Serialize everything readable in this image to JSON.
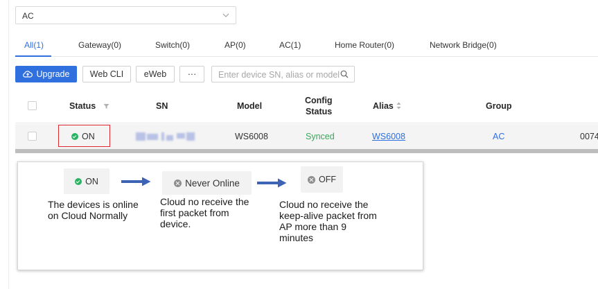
{
  "group_select": {
    "value": "AC"
  },
  "tabs": [
    {
      "label": "All(1)",
      "active": true
    },
    {
      "label": "Gateway(0)"
    },
    {
      "label": "Switch(0)"
    },
    {
      "label": "AP(0)"
    },
    {
      "label": "AC(1)"
    },
    {
      "label": "Home Router(0)"
    },
    {
      "label": "Network Bridge(0)"
    }
  ],
  "toolbar": {
    "upgrade_label": "Upgrade",
    "webcli_label": "Web CLI",
    "eweb_label": "eWeb",
    "more_label": "···",
    "search_placeholder": "Enter device SN, alias or model"
  },
  "table": {
    "headers": {
      "status": "Status",
      "sn": "SN",
      "model": "Model",
      "config_status_line1": "Config",
      "config_status_line2": "Status",
      "alias": "Alias",
      "group": "Group"
    },
    "rows": [
      {
        "status": "ON",
        "model": "WS6008",
        "config_status": "Synced",
        "alias": "WS6008",
        "group": "AC",
        "trailing": "0074"
      }
    ]
  },
  "legend": {
    "on": {
      "label": "ON",
      "desc": [
        "The devices is online",
        "on Cloud Normally"
      ]
    },
    "never_online": {
      "label": "Never Online",
      "desc": [
        "Cloud no receive the",
        "first packet from",
        "device."
      ]
    },
    "off": {
      "label": "OFF",
      "desc": [
        "Cloud no receive the",
        "keep-alive packet from",
        "AP more than 9",
        "minutes"
      ]
    }
  },
  "colors": {
    "accent": "#2f6fde",
    "online": "#28b463",
    "synced": "#3aa55d",
    "highlight": "#e0262f",
    "offline": "#8e8e8e"
  }
}
